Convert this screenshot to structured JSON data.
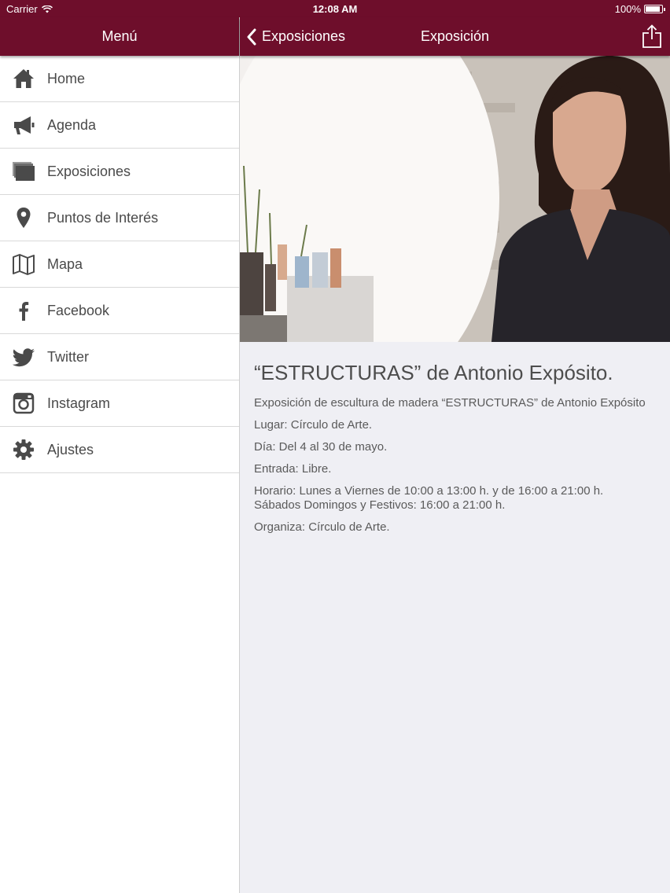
{
  "status_bar": {
    "carrier": "Carrier",
    "time": "12:08 AM",
    "battery": "100%",
    "battery_level": 1.0
  },
  "menu": {
    "title": "Menú",
    "items": [
      {
        "label": "Home",
        "icon": "home-icon"
      },
      {
        "label": "Agenda",
        "icon": "megaphone-icon"
      },
      {
        "label": "Exposiciones",
        "icon": "gallery-icon"
      },
      {
        "label": "Puntos de Interés",
        "icon": "map-pin-icon"
      },
      {
        "label": "Mapa",
        "icon": "map-icon"
      },
      {
        "label": "Facebook",
        "icon": "facebook-icon"
      },
      {
        "label": "Twitter",
        "icon": "twitter-icon"
      },
      {
        "label": "Instagram",
        "icon": "instagram-icon"
      },
      {
        "label": "Ajustes",
        "icon": "gear-icon"
      }
    ]
  },
  "nav": {
    "back_label": "Exposiciones",
    "title": "Exposición",
    "share_icon": "share-icon"
  },
  "exhibition": {
    "title": "“ESTRUCTURAS” de Antonio Expósito.",
    "description": "Exposición de escultura de madera “ESTRUCTURAS” de Antonio Expósito",
    "lugar": "Lugar: Círculo de Arte.",
    "dia": "Día: Del 4 al 30 de mayo.",
    "entrada": "Entrada: Libre.",
    "horario_1": "Horario: Lunes a Viernes de 10:00 a 13:00 h. y de 16:00 a 21:00 h.",
    "horario_2": "Sábados Domingos y Festivos: 16:00 a 21:00 h.",
    "organiza": "Organiza: Círculo de Arte."
  },
  "colors": {
    "brand": "#6e0e2b",
    "menu_text": "#4a4a4a",
    "content_bg": "#efeff4"
  }
}
